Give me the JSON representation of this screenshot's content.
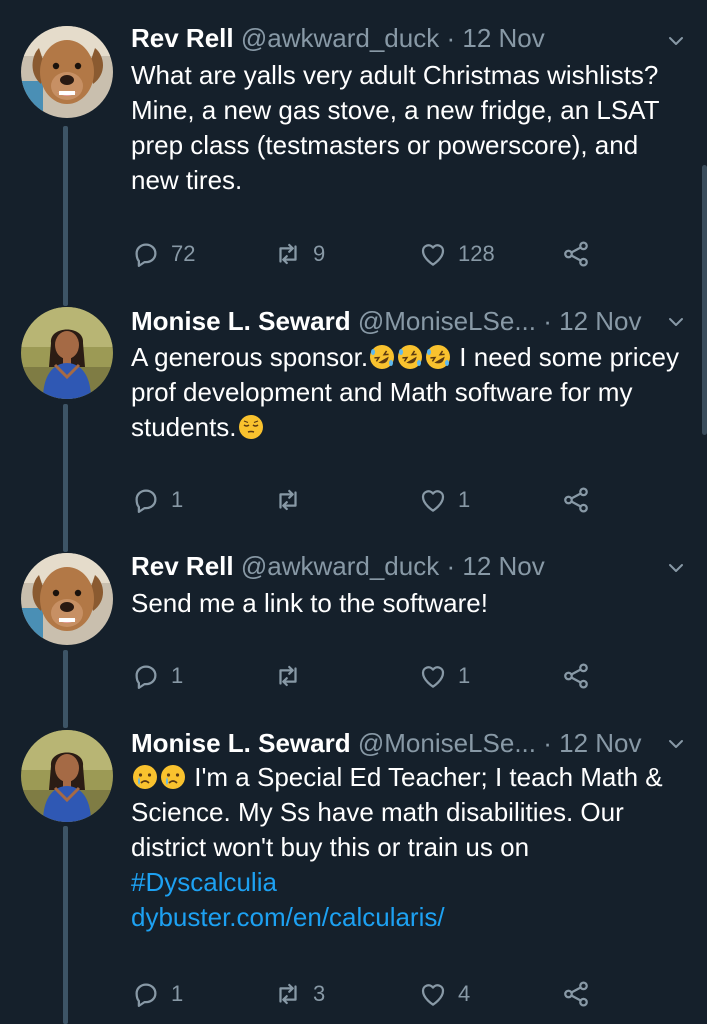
{
  "tweets": [
    {
      "name": "Rev Rell",
      "handle": "@awkward_duck",
      "dot": "·",
      "date": "12 Nov",
      "avatar": "dog-avatar",
      "text": "What are yalls very adult Christmas wishlists? Mine, a new gas stove, a new fridge, an LSAT prep class (testmasters or powerscore), and new tires.",
      "replies": "72",
      "retweets": "9",
      "likes": "128"
    },
    {
      "name": "Monise L. Seward",
      "handle": "@MoniseLSe...",
      "dot": "·",
      "date": "12 Nov",
      "avatar": "woman-avatar",
      "text_before_emoji": "A generous sponsor.",
      "text_after_emoji": " I need some pricey prof development and Math software for my students.",
      "emoji_run_1": [
        "rolling-laughing-emoji",
        "rolling-laughing-emoji",
        "rolling-laughing-emoji"
      ],
      "emoji_end": "relieved-face-emoji",
      "replies": "1",
      "retweets": "",
      "likes": "1"
    },
    {
      "name": "Rev Rell",
      "handle": "@awkward_duck",
      "dot": "·",
      "date": "12 Nov",
      "avatar": "dog-avatar",
      "text": "Send me a link to the software!",
      "replies": "1",
      "retweets": "",
      "likes": "1"
    },
    {
      "name": "Monise L. Seward",
      "handle": "@MoniseLSe...",
      "dot": "·",
      "date": "12 Nov",
      "avatar": "woman-avatar",
      "emoji_start": [
        "crying-face-emoji",
        "crying-face-emoji"
      ],
      "text": " I'm a Special Ed Teacher; I teach Math & Science. My Ss have math disabilities. Our district won't buy this or train us on",
      "hashtag": "#Dyscalculia",
      "link": "dybuster.com/en/calcularis/",
      "replies": "1",
      "retweets": "3",
      "likes": "4"
    }
  ],
  "icons": {
    "reply": "reply-icon",
    "retweet": "retweet-icon",
    "like": "heart-icon",
    "share": "share-icon",
    "caret": "chevron-down-icon"
  },
  "colors": {
    "background": "#15202b",
    "text": "#ffffff",
    "secondary": "#8899a6",
    "link": "#1da1f2",
    "thread_line": "#3d5466"
  }
}
